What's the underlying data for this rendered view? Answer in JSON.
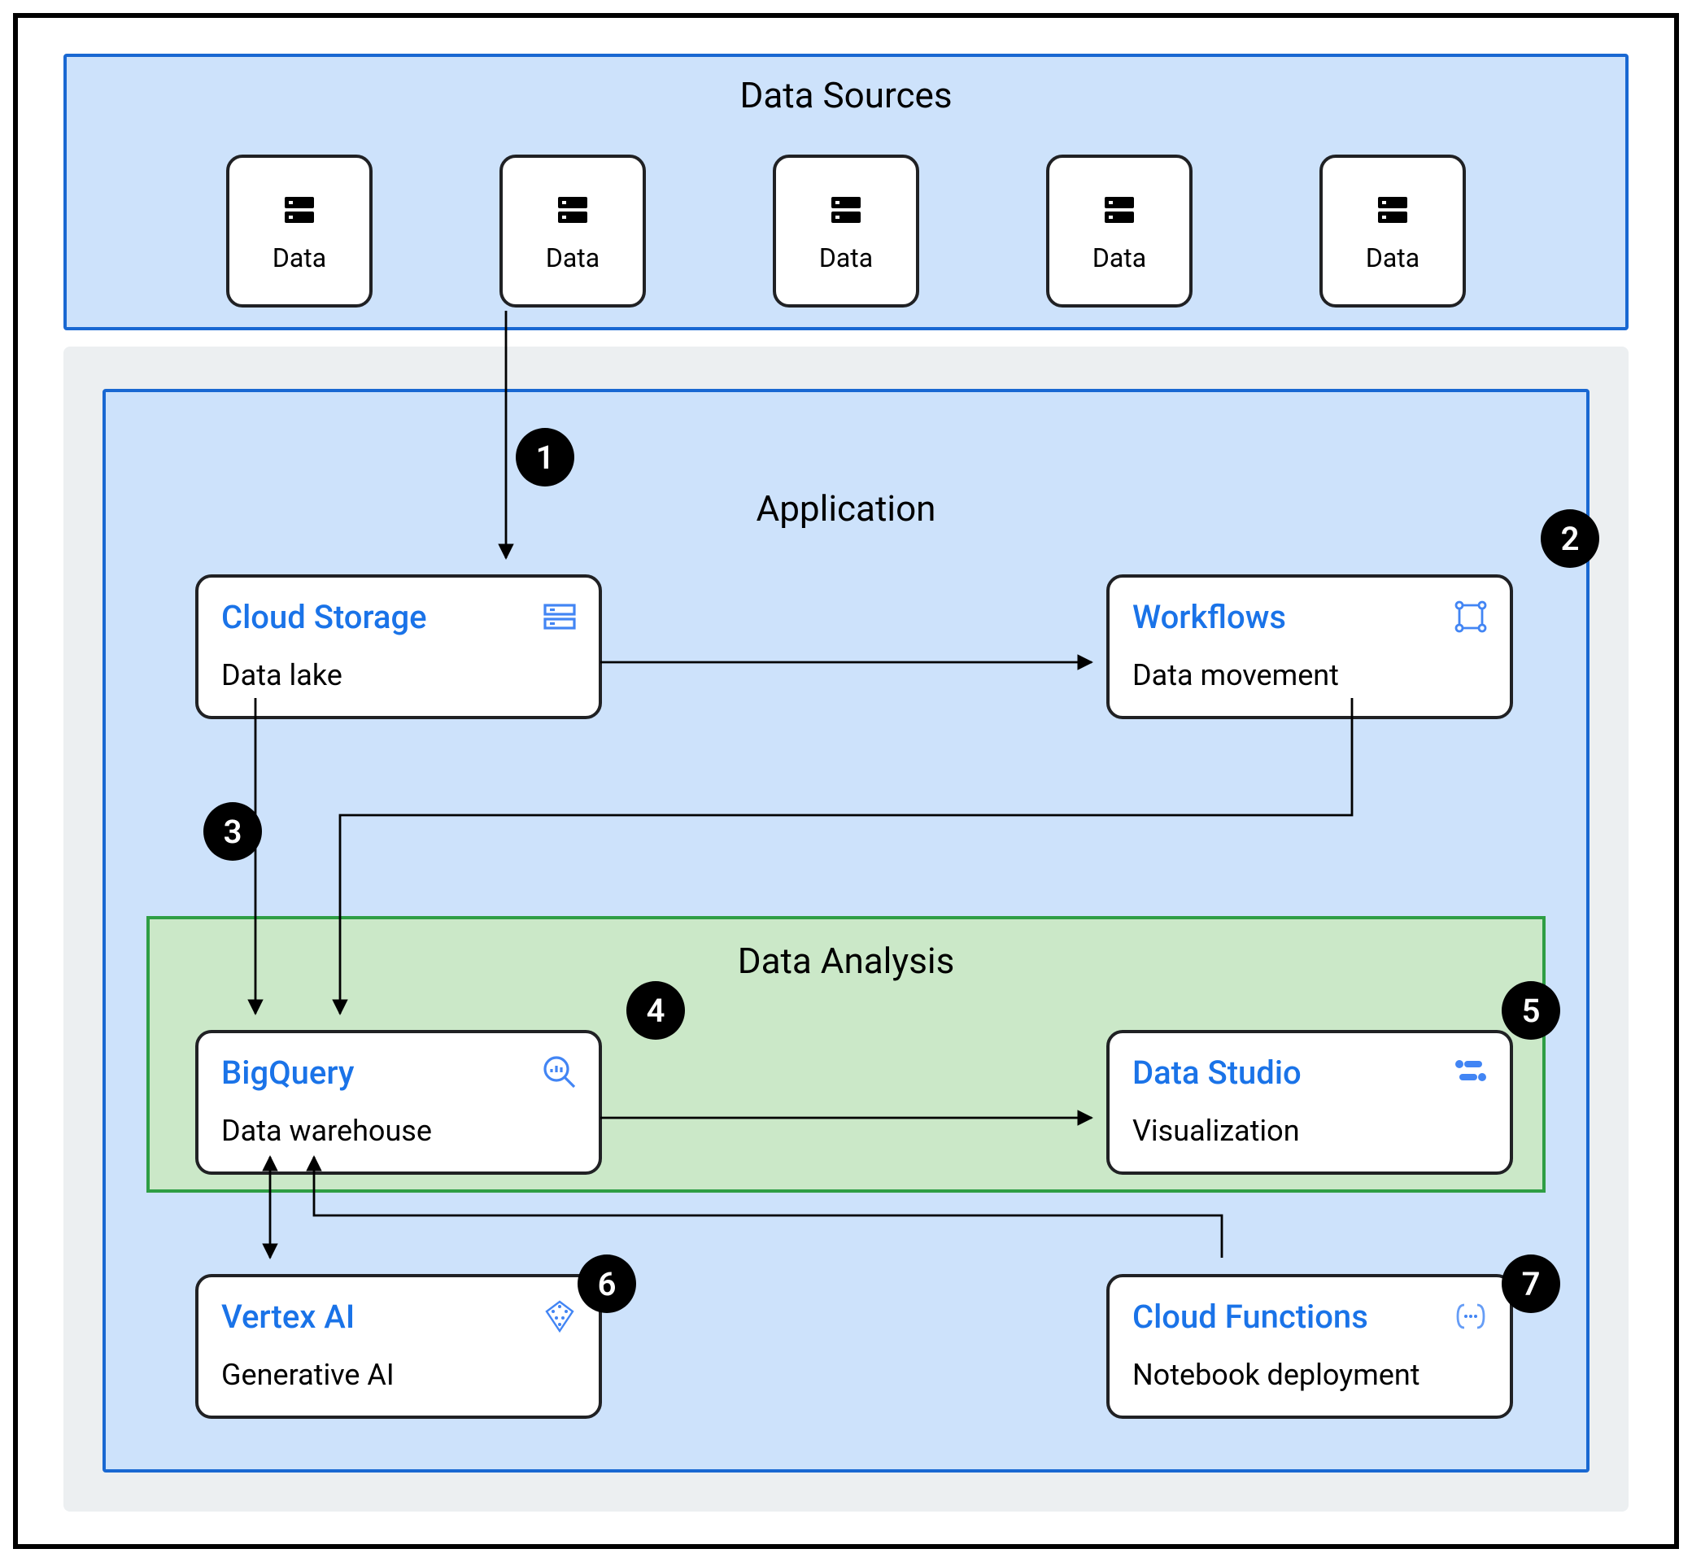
{
  "sections": {
    "data_sources": {
      "title": "Data Sources"
    },
    "application": {
      "title": "Application"
    },
    "analysis": {
      "title": "Data Analysis"
    }
  },
  "data_boxes": [
    {
      "label": "Data"
    },
    {
      "label": "Data"
    },
    {
      "label": "Data"
    },
    {
      "label": "Data"
    },
    {
      "label": "Data"
    }
  ],
  "components": {
    "cloud_storage": {
      "title": "Cloud Storage",
      "subtitle": "Data lake",
      "icon": "storage-icon"
    },
    "workflows": {
      "title": "Workflows",
      "subtitle": "Data movement",
      "icon": "workflows-icon"
    },
    "bigquery": {
      "title": "BigQuery",
      "subtitle": "Data warehouse",
      "icon": "bigquery-icon"
    },
    "data_studio": {
      "title": "Data Studio",
      "subtitle": "Visualization",
      "icon": "data-studio-icon"
    },
    "vertex_ai": {
      "title": "Vertex AI",
      "subtitle": "Generative AI",
      "icon": "vertex-ai-icon"
    },
    "cloud_functions": {
      "title": "Cloud Functions",
      "subtitle": "Notebook deployment",
      "icon": "cloud-functions-icon"
    }
  },
  "steps": {
    "s1": "1",
    "s2": "2",
    "s3": "3",
    "s4": "4",
    "s5": "5",
    "s6": "6",
    "s7": "7"
  },
  "flow": [
    {
      "from": "data_sources",
      "to": "cloud_storage",
      "step": 1
    },
    {
      "from": "cloud_storage",
      "to": "workflows",
      "step": 2
    },
    {
      "from": "cloud_storage",
      "to": "bigquery",
      "step": 3
    },
    {
      "from": "workflows",
      "to": "bigquery",
      "step": 4
    },
    {
      "from": "bigquery",
      "to": "data_studio",
      "step": 5
    },
    {
      "from": "bigquery",
      "to": "vertex_ai",
      "step": 6,
      "bidirectional": true
    },
    {
      "from": "cloud_functions",
      "to": "bigquery",
      "step": 7
    }
  ]
}
